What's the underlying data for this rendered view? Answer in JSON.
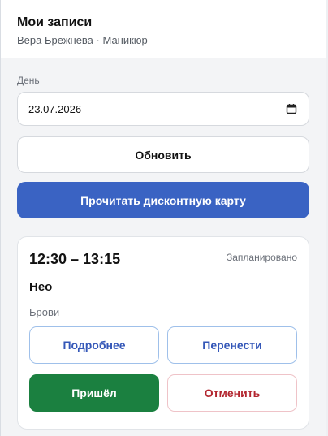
{
  "header": {
    "title": "Мои записи",
    "subtitle": "Вера Брежнева · Маникюр"
  },
  "filter": {
    "day_label": "День",
    "date_value": "23.07.2026",
    "calendar_icon": "calendar-icon"
  },
  "actions": {
    "refresh_label": "Обновить",
    "read_card_label": "Прочитать дисконтную карту"
  },
  "appointments": [
    {
      "time": "12:30 – 13:15",
      "status": "Запланировано",
      "client": "Нео",
      "service": "Брови",
      "details_label": "Подробнее",
      "reschedule_label": "Перенести",
      "arrived_label": "Пришёл",
      "cancel_label": "Отменить"
    }
  ],
  "colors": {
    "primary": "#3a63c3",
    "success": "#1b8040",
    "danger": "#b3262f",
    "outline_blue": "#9fc0ea"
  }
}
